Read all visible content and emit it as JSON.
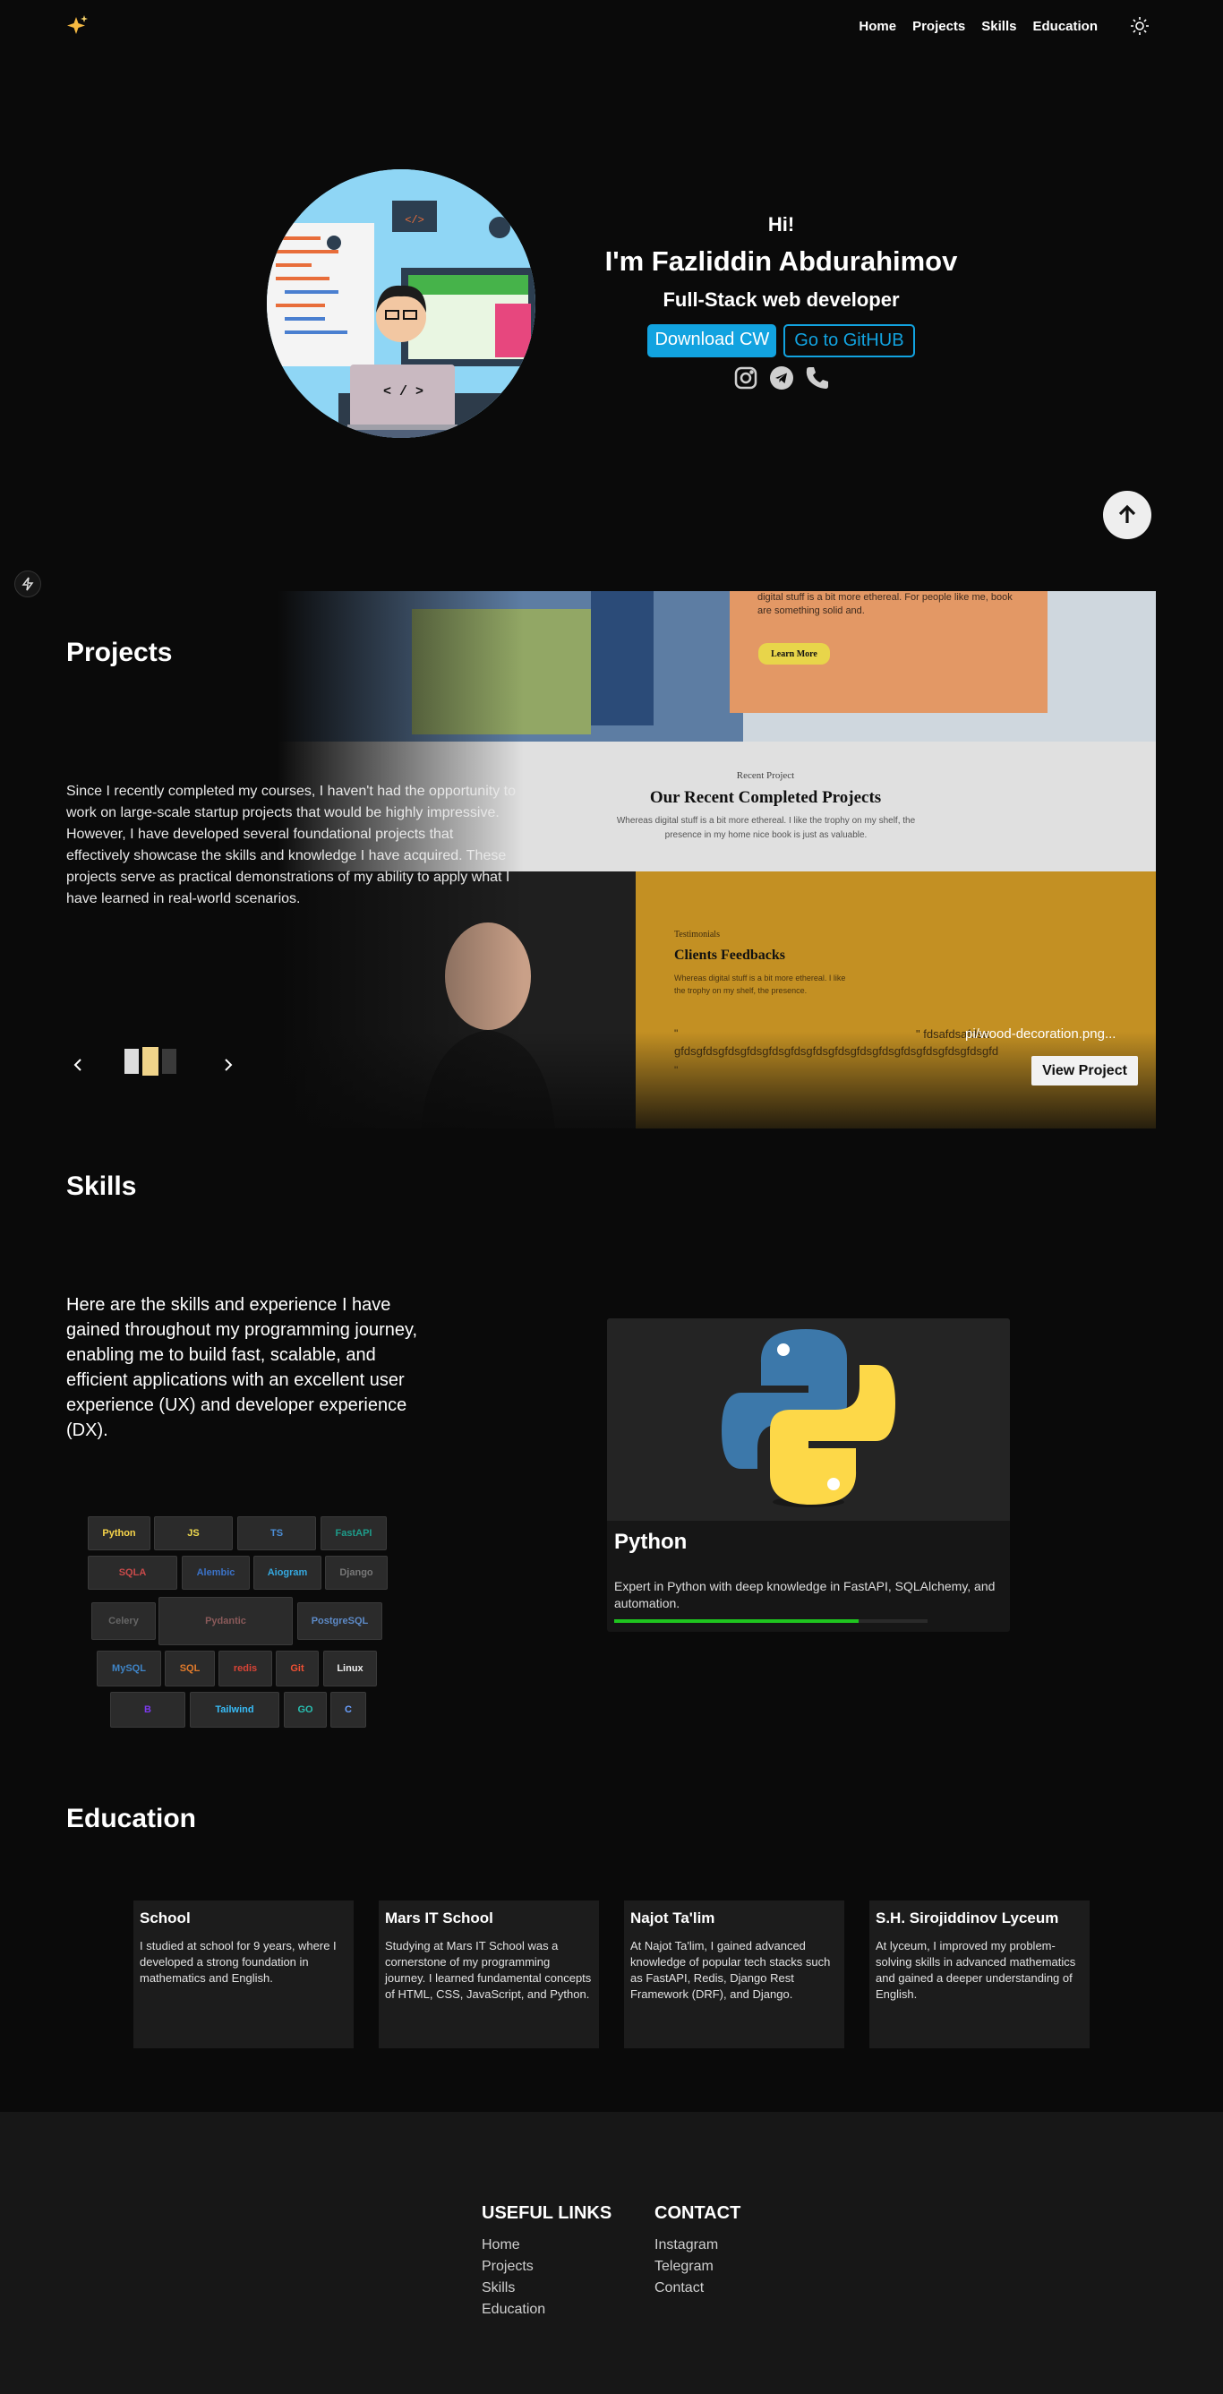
{
  "nav": {
    "logo_icon": "sparkles-icon",
    "links": [
      "Home",
      "Projects",
      "Skills",
      "Education"
    ],
    "theme_icon": "sun-icon"
  },
  "hero": {
    "greeting": "Hi!",
    "name": "I'm Fazliddin Abdurahimov",
    "role": "Full-Stack web developer",
    "download_label": "Download CW",
    "github_label": "Go to GitHUB",
    "avatar_code": "< / >",
    "socials": [
      "instagram-icon",
      "telegram-icon",
      "phone-icon"
    ]
  },
  "projects": {
    "title": "Projects",
    "description": "Since I recently completed my courses, I haven't had the opportunity to work on large-scale startup projects that would be highly impressive. However, I have developed several foundational projects that effectively showcase the skills and knowledge I have acquired. These projects serve as practical demonstrations of my ability to apply what I have learned in real-world scenarios.",
    "file_name": "pi/wood-decoration.png...",
    "view_label": "View Project",
    "preview": {
      "top_text": "digital stuff is a bit more ethereal. For people like me, book are something solid and.",
      "learn_more": "Learn More",
      "recent_kicker": "Recent Project",
      "recent_title": "Our Recent Completed Projects",
      "recent_text": "Whereas digital stuff is a bit more ethereal. I like the trophy on my shelf, the presence in my home nice book is just as valuable.",
      "testimonials_kicker": "Testimonials",
      "testimonials_title": "Clients Feedbacks",
      "testimonials_text": "Whereas digital stuff is a bit more ethereal. I like the trophy on my shelf, the presence.",
      "quote_open": "\"",
      "fd_text": "\" fdsafdsafdsa",
      "gf_text": "gfdsgfdsgfdsgfdsgfdsgfdsgfdsgfdsgfdsgfdsgfdsgfdsgfdsgfdsgfd",
      "quote_close": "\""
    }
  },
  "skills": {
    "title": "Skills",
    "description": "Here are the skills and experience I have gained throughout my programming journey, enabling me to build fast, scalable, and efficient applications with an excellent user experience (UX) and developer experience (DX).",
    "selected": {
      "name": "Python",
      "text": "Expert in Python with deep knowledge in FastAPI, SQLAlchemy, and automation.",
      "level": 0.78
    },
    "tiles": [
      "Python",
      "JS",
      "TS",
      "FastAPI",
      "SQLA",
      "Alembic",
      "Aiogram",
      "Django",
      "Celery",
      "Pydantic",
      "PostgreSQL",
      "MySQL",
      "SQL",
      "redis",
      "Git",
      "Linux",
      "B",
      "Tailwind",
      "GO",
      "C"
    ]
  },
  "education": {
    "title": "Education",
    "cards": [
      {
        "title": "School",
        "text": "I studied at school for 9 years, where I developed a strong foundation in mathematics and English."
      },
      {
        "title": "Mars IT School",
        "text": "Studying at Mars IT School was a cornerstone of my programming journey. I learned fundamental concepts of HTML, CSS, JavaScript, and Python."
      },
      {
        "title": "Najot Ta'lim",
        "text": "At Najot Ta'lim, I gained advanced knowledge of popular tech stacks such as FastAPI, Redis, Django Rest Framework (DRF), and Django."
      },
      {
        "title": "S.H. Sirojiddinov Lyceum",
        "text": "At lyceum, I improved my problem-solving skills in advanced mathematics and gained a deeper understanding of English."
      }
    ]
  },
  "footer": {
    "useful_title": "USEFUL LINKS",
    "useful": [
      "Home",
      "Projects",
      "Skills",
      "Education"
    ],
    "contact_title": "CONTACT",
    "contact": [
      "Instagram",
      "Telegram",
      "Contact"
    ]
  },
  "colors": {
    "accent": "#12a3e0",
    "progress": "#1fc51f",
    "background": "#0a0a0a",
    "footer": "#171717"
  }
}
